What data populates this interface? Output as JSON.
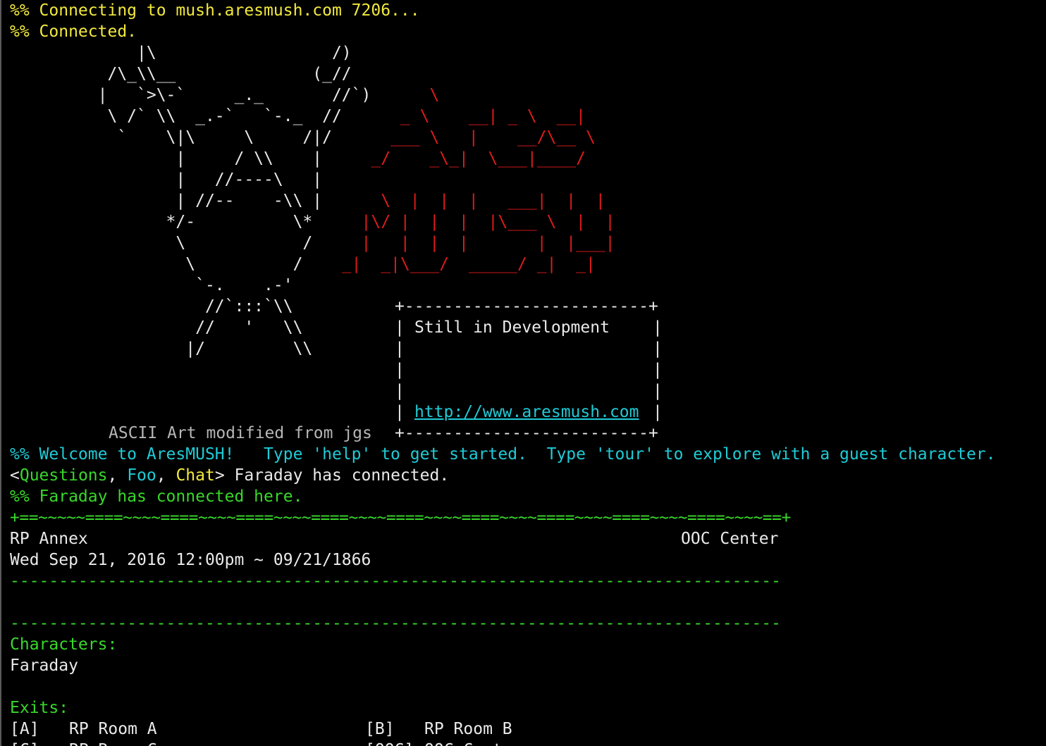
{
  "connection": {
    "connecting": "%% Connecting to mush.aresmush.com 7206...",
    "connected": "%% Connected."
  },
  "art": {
    "rows": [
      {
        "left": "             |\\                  /)",
        "right": ""
      },
      {
        "left": "          /\\_\\\\__              (_//",
        "right": ""
      },
      {
        "left": "         |   `>\\-`     _._       //`)",
        "right": "      \\"
      },
      {
        "left": "          \\ /` \\\\  _.-`   `-._  //",
        "right": "      _ \\    __| _ \\  __|"
      },
      {
        "left": "           `    \\|\\     \\     /|/",
        "right": "      ___ \\   |    __/\\__ \\"
      },
      {
        "left": "                 |     / \\\\    |",
        "right": "     _/    _\\_|  \\___|____/"
      },
      {
        "left": "                 |   //----\\   |",
        "right": ""
      },
      {
        "left": "                 | //--    -\\\\ |",
        "right": "      \\  |  |  |   ___|  |  |"
      },
      {
        "left": "                */-          \\*",
        "right": "     |\\/ |  |  |  |\\___ \\  |  |"
      },
      {
        "left": "                 \\            /",
        "right": "     |   |  |  |       |  |___|"
      },
      {
        "left": "                  \\          /",
        "right": "    _|  _|\\___/  _____/ _|  _|"
      },
      {
        "left": "                   `-.    .-'",
        "right": ""
      }
    ],
    "tail": [
      "                    //`:::`\\\\",
      "                   //   '   \\\\",
      "                  |/         \\\\"
    ],
    "credit": "ASCII Art modified from jgs"
  },
  "dev_box": {
    "border": "+-------------------------+",
    "title": "Still in Development",
    "url": "http://www.aresmush.com"
  },
  "messages": {
    "welcome": "%% Welcome to AresMUSH!   Type 'help' to get started.  Type 'tour' to explore with a guest character.",
    "channel_open": "<",
    "channel_questions": "Questions",
    "channel_sep1": ", ",
    "channel_foo": "Foo",
    "channel_sep2": ", ",
    "channel_chat": "Chat",
    "channel_rest": "> Faraday has connected.",
    "connected_here": "%% Faraday has connected here."
  },
  "room": {
    "top_border": "+==~~~~~====~~~~====~~~~====~~~~====~~~~====~~~~====~~~~====~~~~====~~~~====~~~~==+",
    "name": "RP Annex",
    "area": "OOC Center",
    "datetime": "Wed Sep 21, 2016 12:00pm ~ 09/21/1866",
    "divider": "-------------------------------------------------------------------------------",
    "characters_heading": "Characters:",
    "characters": [
      "Faraday"
    ],
    "exits_heading": "Exits:",
    "exits": [
      {
        "key": "[A]",
        "name": "RP Room A"
      },
      {
        "key": "[B]",
        "name": "RP Room B"
      },
      {
        "key": "[C]",
        "name": "RP Room C"
      },
      {
        "key": "[OOC]",
        "name": "OOC Center"
      }
    ]
  },
  "colors": {
    "background": "#000000",
    "system_yellow": "#f2e93d",
    "logo_red": "#e01b1b",
    "cyan": "#1fcbd6",
    "green": "#38d82a",
    "text": "#eaeaea"
  }
}
